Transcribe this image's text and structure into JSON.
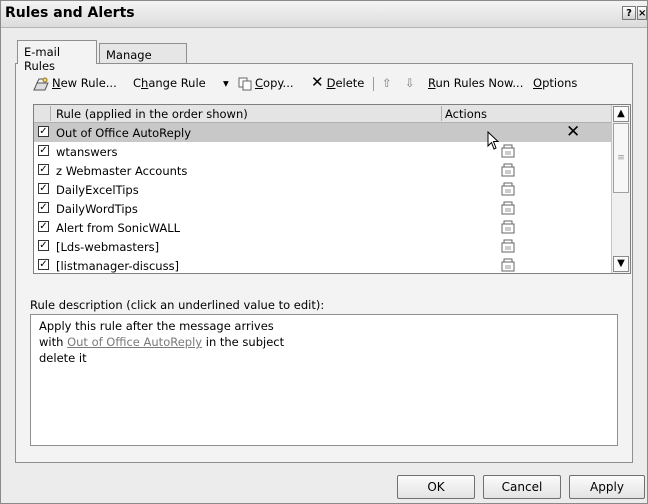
{
  "window": {
    "title": "Rules and Alerts",
    "help_glyph": "?",
    "close_glyph": "×"
  },
  "tabs": [
    {
      "label": "E-mail Rules",
      "active": true
    },
    {
      "label": "Manage Alerts",
      "active": false
    }
  ],
  "toolbar": {
    "new_rule_pre": "",
    "new_rule_u": "N",
    "new_rule_post": "ew Rule...",
    "change_rule_pre": "C",
    "change_rule_u": "h",
    "change_rule_post": "ange Rule",
    "dropdown_glyph": "▾",
    "copy_pre": "",
    "copy_u": "C",
    "copy_post": "opy...",
    "delete_pre": "",
    "delete_u": "D",
    "delete_post": "elete",
    "delete_glyph": "✕",
    "move_up_glyph": "⇧",
    "move_down_glyph": "⇩",
    "run_rules_pre": "",
    "run_rules_u": "R",
    "run_rules_post": "un Rules Now...",
    "options_pre": "",
    "options_u": "O",
    "options_post": "ptions"
  },
  "rules_list": {
    "columns": [
      "Rule (applied in the order shown)",
      "Actions"
    ],
    "rows": [
      {
        "name": "Out of Office AutoReply",
        "checked": true,
        "selected": true,
        "action": "delete-x"
      },
      {
        "name": "wtanswers",
        "checked": true,
        "selected": false,
        "action": "move-to-folder"
      },
      {
        "name": "z Webmaster Accounts",
        "checked": true,
        "selected": false,
        "action": "move-to-folder"
      },
      {
        "name": "DailyExcelTips",
        "checked": true,
        "selected": false,
        "action": "move-to-folder"
      },
      {
        "name": "DailyWordTips",
        "checked": true,
        "selected": false,
        "action": "move-to-folder"
      },
      {
        "name": "Alert from SonicWALL",
        "checked": true,
        "selected": false,
        "action": "move-to-folder"
      },
      {
        "name": "[Lds-webmasters]",
        "checked": true,
        "selected": false,
        "action": "move-to-folder"
      },
      {
        "name": "[listmanager-discuss]",
        "checked": true,
        "selected": false,
        "action": "move-to-folder"
      }
    ],
    "check_glyph": "✓",
    "selected_action_glyph": "✕",
    "scroll_up_glyph": "▲",
    "scroll_down_glyph": "▼",
    "scroll_thumb_glyph": "≡"
  },
  "description": {
    "label": "Rule description (click an underlined value to edit):",
    "line1": "Apply this rule after the message arrives",
    "line2_pre": "with ",
    "line2_link": "Out of Office AutoReply",
    "line2_post": " in the subject",
    "line3": "delete it"
  },
  "buttons": {
    "ok": "OK",
    "cancel": "Cancel",
    "apply": "Apply"
  },
  "colors": {
    "selection": "#c8c8c8",
    "link": "#7a7a7a",
    "window_bg": "#ececec"
  }
}
